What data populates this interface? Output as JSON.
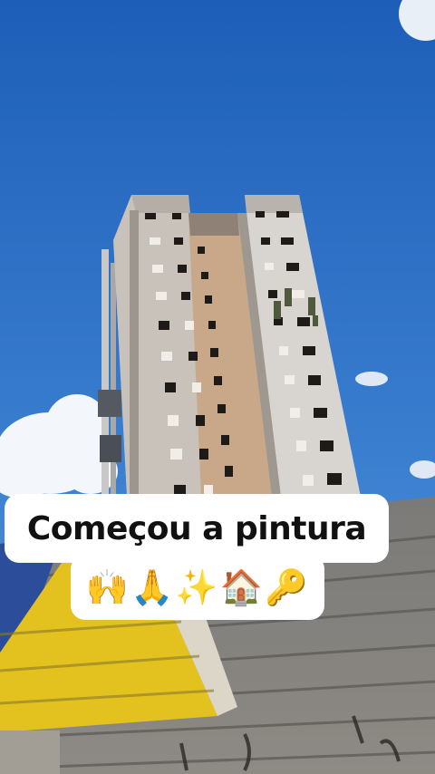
{
  "caption": {
    "line1": "Começou a pintura",
    "line2": "🙌🙏✨🏠🔑"
  }
}
